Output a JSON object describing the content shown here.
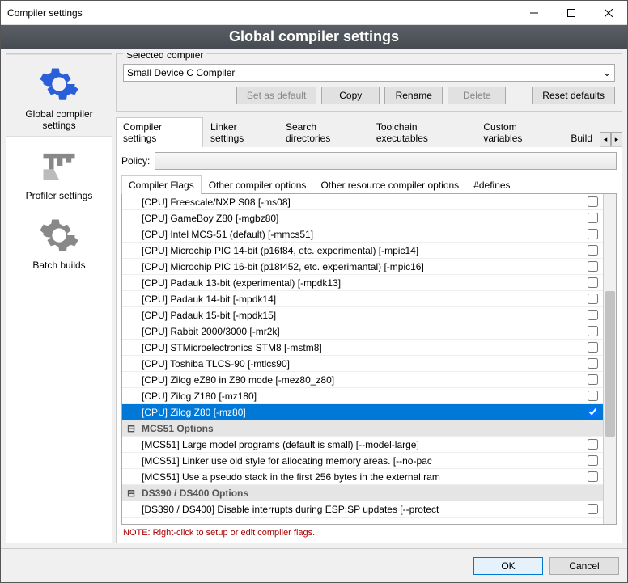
{
  "title": "Compiler settings",
  "header": "Global compiler settings",
  "sidebar": [
    {
      "id": "global",
      "label": "Global compiler settings",
      "selected": true
    },
    {
      "id": "profiler",
      "label": "Profiler settings"
    },
    {
      "id": "batch",
      "label": "Batch builds"
    }
  ],
  "selected_compiler": {
    "group_label": "Selected compiler",
    "value": "Small Device C Compiler",
    "buttons": {
      "set_default": "Set as default",
      "copy": "Copy",
      "rename": "Rename",
      "delete": "Delete",
      "reset": "Reset defaults"
    }
  },
  "main_tabs": [
    "Compiler settings",
    "Linker settings",
    "Search directories",
    "Toolchain executables",
    "Custom variables",
    "Build"
  ],
  "main_tab_active": 0,
  "policy_label": "Policy:",
  "sub_tabs": [
    "Compiler Flags",
    "Other compiler options",
    "Other resource compiler options",
    "#defines"
  ],
  "sub_tab_active": 0,
  "flags": [
    {
      "type": "flag",
      "label": "[CPU] Freescale/NXP S08  [-ms08]",
      "checked": false
    },
    {
      "type": "flag",
      "label": "[CPU] GameBoy Z80  [-mgbz80]",
      "checked": false
    },
    {
      "type": "flag",
      "label": "[CPU] Intel MCS-51 (default)  [-mmcs51]",
      "checked": false
    },
    {
      "type": "flag",
      "label": "[CPU] Microchip PIC 14-bit (p16f84, etc. experimental)  [-mpic14]",
      "checked": false
    },
    {
      "type": "flag",
      "label": "[CPU] Microchip PIC 16-bit (p18f452, etc. experimantal)  [-mpic16]",
      "checked": false
    },
    {
      "type": "flag",
      "label": "[CPU] Padauk 13-bit (experimental)  [-mpdk13]",
      "checked": false
    },
    {
      "type": "flag",
      "label": "[CPU] Padauk 14-bit  [-mpdk14]",
      "checked": false
    },
    {
      "type": "flag",
      "label": "[CPU] Padauk 15-bit  [-mpdk15]",
      "checked": false
    },
    {
      "type": "flag",
      "label": "[CPU] Rabbit 2000/3000  [-mr2k]",
      "checked": false
    },
    {
      "type": "flag",
      "label": "[CPU] STMicroelectronics STM8  [-mstm8]",
      "checked": false
    },
    {
      "type": "flag",
      "label": "[CPU] Toshiba TLCS-90  [-mtlcs90]",
      "checked": false
    },
    {
      "type": "flag",
      "label": "[CPU] Zilog eZ80 in Z80 mode  [-mez80_z80]",
      "checked": false
    },
    {
      "type": "flag",
      "label": "[CPU] Zilog Z180  [-mz180]",
      "checked": false
    },
    {
      "type": "flag",
      "label": "[CPU] Zilog Z80  [-mz80]",
      "checked": true,
      "selected": true
    },
    {
      "type": "cat",
      "label": "MCS51 Options"
    },
    {
      "type": "flag",
      "label": "[MCS51] Large model programs (default is small)  [--model-large]",
      "checked": false
    },
    {
      "type": "flag",
      "label": "[MCS51] Linker use old style for allocating memory areas.  [--no-pac",
      "checked": false
    },
    {
      "type": "flag",
      "label": "[MCS51] Use a pseudo stack in the first 256 bytes in the external ram",
      "checked": false
    },
    {
      "type": "cat",
      "label": "DS390 / DS400 Options"
    },
    {
      "type": "flag",
      "label": "[DS390 / DS400] Disable interrupts during ESP:SP updates  [--protect",
      "checked": false
    }
  ],
  "note": "NOTE: Right-click to setup or edit compiler flags.",
  "footer": {
    "ok": "OK",
    "cancel": "Cancel"
  }
}
